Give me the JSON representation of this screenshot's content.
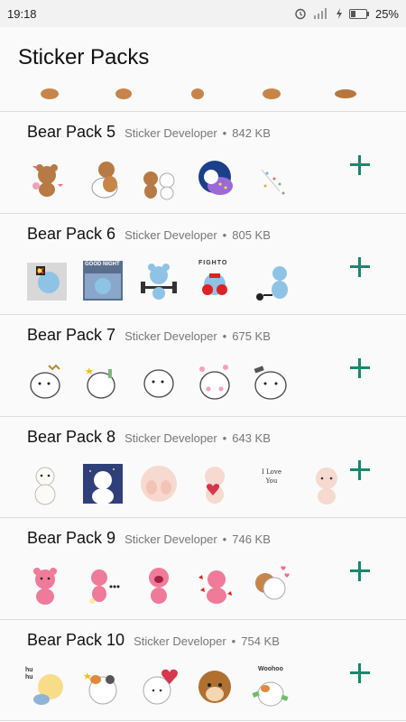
{
  "status": {
    "time": "19:18",
    "battery": "25%"
  },
  "app_bar": {
    "title": "Sticker Packs"
  },
  "packs": [
    {
      "name": "Bear Pack 5",
      "author": "Sticker Developer",
      "size": "842 KB"
    },
    {
      "name": "Bear Pack 6",
      "author": "Sticker Developer",
      "size": "805 KB"
    },
    {
      "name": "Bear Pack 7",
      "author": "Sticker Developer",
      "size": "675 KB"
    },
    {
      "name": "Bear Pack 8",
      "author": "Sticker Developer",
      "size": "643 KB"
    },
    {
      "name": "Bear Pack 9",
      "author": "Sticker Developer",
      "size": "746 KB"
    },
    {
      "name": "Bear Pack 10",
      "author": "Sticker Developer",
      "size": "754 KB"
    }
  ],
  "sticker_text": {
    "good_night": "GOOD NIGHT",
    "fighto": "FIGHTO",
    "i_love_you": "I Love You",
    "huhu": "hu hu",
    "woohoo": "Woohoo"
  },
  "colors": {
    "accent": "#138a6e",
    "divider": "#dcdcdc",
    "brown_bear": "#c8854a",
    "blue_bear": "#8ec3e6",
    "pink_bear": "#f07a9a"
  },
  "icons": [
    "alarm-icon",
    "signal-icon",
    "charging-icon",
    "battery-icon",
    "add-icon"
  ]
}
